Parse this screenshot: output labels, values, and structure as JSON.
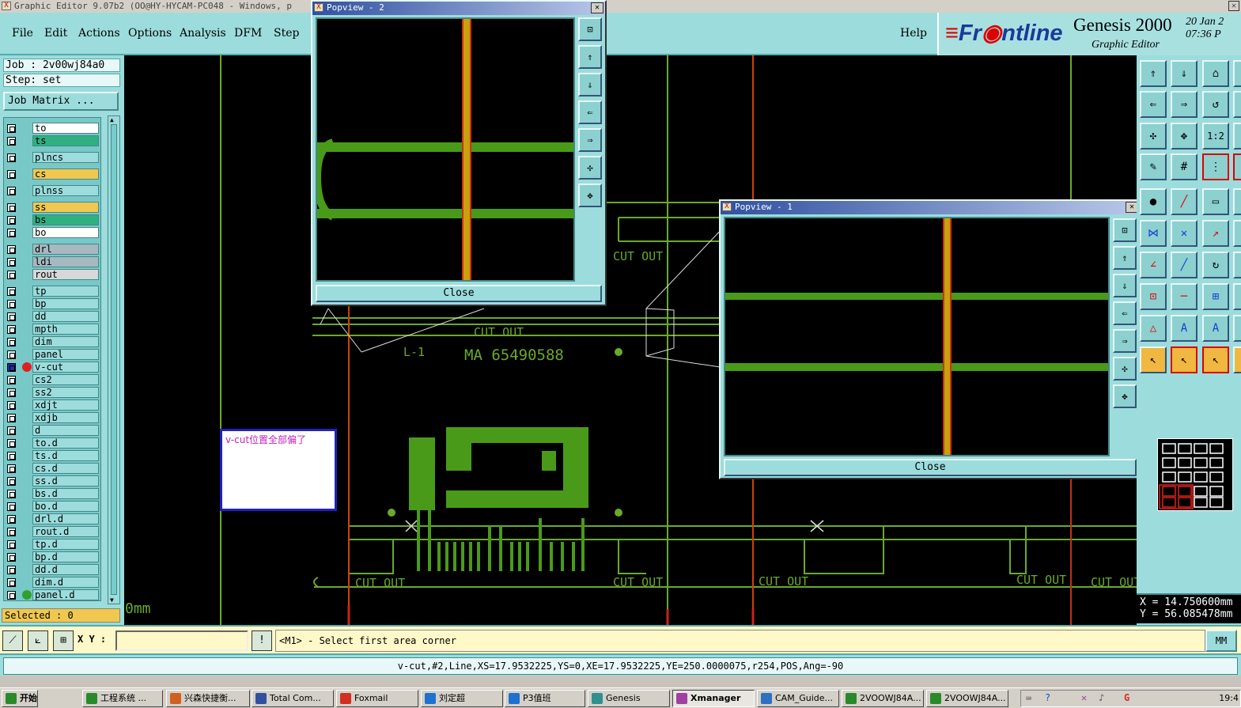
{
  "window": {
    "title": "Graphic Editor 9.07b2  (OO@HY-HYCAM-PC048 - Windows, p"
  },
  "menu": [
    "File",
    "Edit",
    "Actions",
    "Options",
    "Analysis",
    "DFM",
    "Step"
  ],
  "help": "Help",
  "brand": {
    "logo_a": "Fr",
    "logo_b": "ntline",
    "product": "Genesis 2000",
    "subtitle": "Graphic Editor",
    "date": "20 Jan 2",
    "time": "07:36 P"
  },
  "job": {
    "job_line": "Job : 2v00wj84a0",
    "step_line": "Step: set",
    "matrix_button": "Job Matrix ..."
  },
  "layers": [
    {
      "name": "to",
      "color": "#ffffff"
    },
    {
      "name": "ts",
      "color": "#30b080"
    },
    {
      "name": "plncs",
      "color": "#9cdcdc"
    },
    {
      "name": "cs",
      "color": "#f0c850"
    },
    {
      "name": "plnss",
      "color": "#9cdcdc"
    },
    {
      "name": "ss",
      "color": "#f0c850"
    },
    {
      "name": "bs",
      "color": "#30b080"
    },
    {
      "name": "bo",
      "color": "#ffffff"
    },
    {
      "name": "drl",
      "color": "#a8b8c0"
    },
    {
      "name": "ldi",
      "color": "#a8b8c0"
    },
    {
      "name": "rout",
      "color": "#d8d8d8"
    },
    {
      "name": "tp",
      "color": "#9cdcdc"
    },
    {
      "name": "bp",
      "color": "#9cdcdc"
    },
    {
      "name": "dd",
      "color": "#9cdcdc"
    },
    {
      "name": "mpth",
      "color": "#9cdcdc"
    },
    {
      "name": "dim",
      "color": "#9cdcdc"
    },
    {
      "name": "panel",
      "color": "#9cdcdc"
    },
    {
      "name": "v-cut",
      "color": "#9cdcdc"
    },
    {
      "name": "cs2",
      "color": "#9cdcdc"
    },
    {
      "name": "ss2",
      "color": "#9cdcdc"
    },
    {
      "name": "xdjt",
      "color": "#9cdcdc"
    },
    {
      "name": "xdjb",
      "color": "#9cdcdc"
    },
    {
      "name": "d",
      "color": "#9cdcdc"
    },
    {
      "name": "to.d",
      "color": "#9cdcdc"
    },
    {
      "name": "ts.d",
      "color": "#9cdcdc"
    },
    {
      "name": "cs.d",
      "color": "#9cdcdc"
    },
    {
      "name": "ss.d",
      "color": "#9cdcdc"
    },
    {
      "name": "bs.d",
      "color": "#9cdcdc"
    },
    {
      "name": "bo.d",
      "color": "#9cdcdc"
    },
    {
      "name": "drl.d",
      "color": "#9cdcdc"
    },
    {
      "name": "rout.d",
      "color": "#9cdcdc"
    },
    {
      "name": "tp.d",
      "color": "#9cdcdc"
    },
    {
      "name": "bp.d",
      "color": "#9cdcdc"
    },
    {
      "name": "dd.d",
      "color": "#9cdcdc"
    },
    {
      "name": "dim.d",
      "color": "#9cdcdc"
    },
    {
      "name": "panel.d",
      "color": "#9cdcdc"
    }
  ],
  "selected": "Selected : 0",
  "canvas": {
    "cutout": "CUT OUT",
    "layer_label": "L-1",
    "part_number": "MA 65490588",
    "scale_label": "0mm",
    "note": "v-cut位置全部偏了"
  },
  "popup2": {
    "title": "Popview - 2",
    "close": "Close"
  },
  "popup1": {
    "title": "Popview - 1",
    "close": "Close"
  },
  "coords": {
    "x": "X = 14.750600mm",
    "y": "Y = 56.085478mm"
  },
  "command": {
    "xy_label": "X Y :",
    "xy_value": "",
    "prompt": "<M1> - Select first area corner",
    "units": "MM"
  },
  "status": "v-cut,#2,Line,XS=17.9532225,YS=0,XE=17.9532225,YE=250.0000075,r254,POS,Ang=-90",
  "taskbar": {
    "start": "开始",
    "tasks": [
      {
        "label": "工程系统 ...",
        "color": "#2a8a2a"
      },
      {
        "label": "兴森快捷衡...",
        "color": "#d06020"
      },
      {
        "label": "Total Com...",
        "color": "#3050a0"
      },
      {
        "label": "Foxmail",
        "color": "#d03020"
      },
      {
        "label": "刘定超",
        "color": "#2070d0"
      },
      {
        "label": "P3值班",
        "color": "#2070d0"
      },
      {
        "label": "Genesis",
        "color": "#309090"
      },
      {
        "label": "Xmanager",
        "color": "#a040a0"
      },
      {
        "label": "CAM_Guide...",
        "color": "#3070c0"
      },
      {
        "label": "2VOOWJ84A...",
        "color": "#2a8a2a"
      },
      {
        "label": "2VOOWJ84A...",
        "color": "#2a8a2a"
      }
    ],
    "clock": "19:4"
  }
}
